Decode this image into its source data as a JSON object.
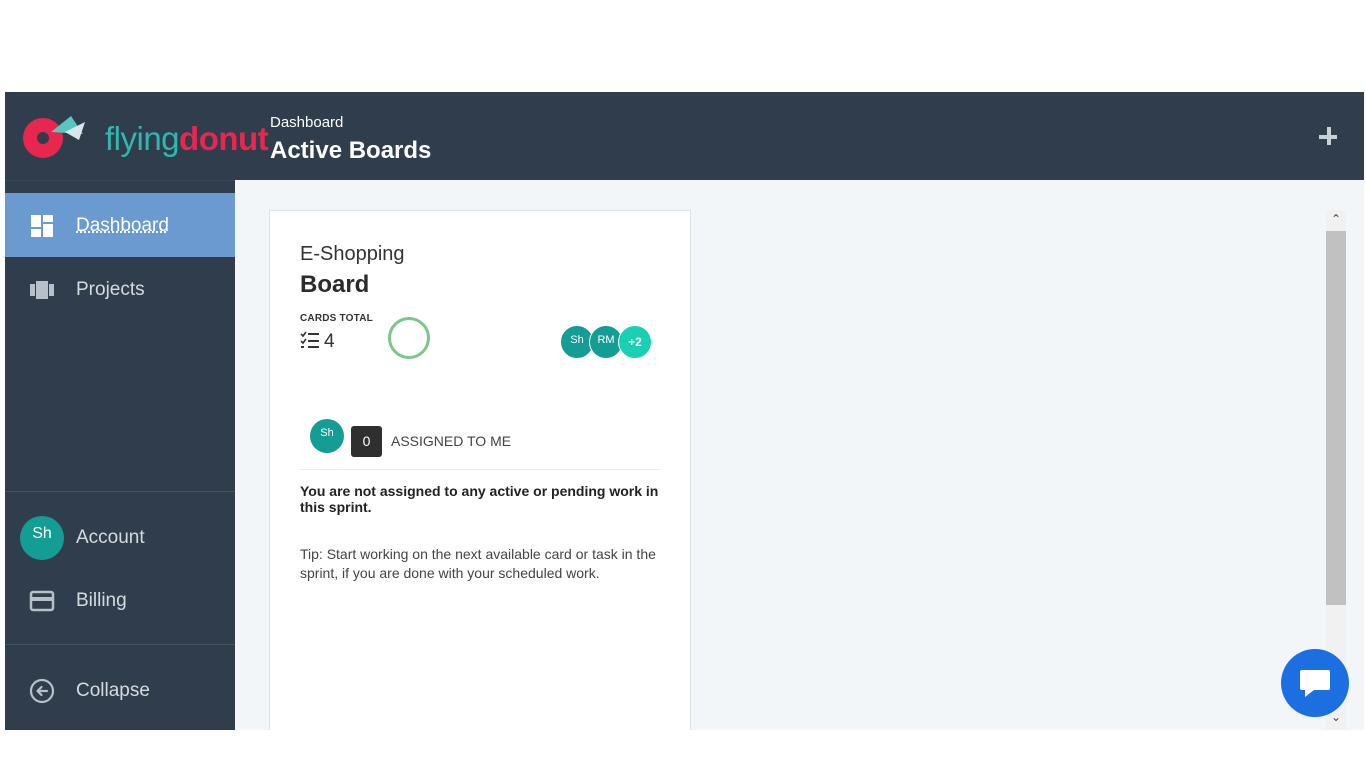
{
  "brand": {
    "logo_part1": "flying",
    "logo_part2": "donut",
    "colors": {
      "teal": "#2fb7b0",
      "red": "#e8264f"
    }
  },
  "header": {
    "breadcrumb": "Dashboard",
    "title": "Active Boards",
    "add_icon": "plus-icon"
  },
  "sidebar": {
    "items": [
      {
        "label": "Dashboard",
        "icon": "dashboard-icon",
        "active": true
      },
      {
        "label": "Projects",
        "icon": "projects-icon",
        "active": false
      }
    ],
    "account": {
      "label": "Account",
      "avatar": "Sh"
    },
    "billing": {
      "label": "Billing",
      "icon": "credit-card-icon"
    },
    "collapse": {
      "label": "Collapse",
      "icon": "arrow-left-circle-icon"
    },
    "active_color": "#6a9ad0"
  },
  "board": {
    "project": "E-Shopping",
    "name": "Board",
    "cards_total_label": "CARDS TOTAL",
    "cards_total": "4",
    "members": [
      "Sh",
      "RM",
      "+2"
    ],
    "assigned": {
      "avatar": "Sh",
      "count": "0",
      "label": "ASSIGNED TO ME"
    },
    "message": "You are not assigned to any active or pending work in this sprint.",
    "tip": "Tip: Start working on the next available card or task in the sprint, if you are done with your scheduled work."
  },
  "chat": {
    "icon": "chat-icon",
    "color": "#1c6fe0"
  }
}
